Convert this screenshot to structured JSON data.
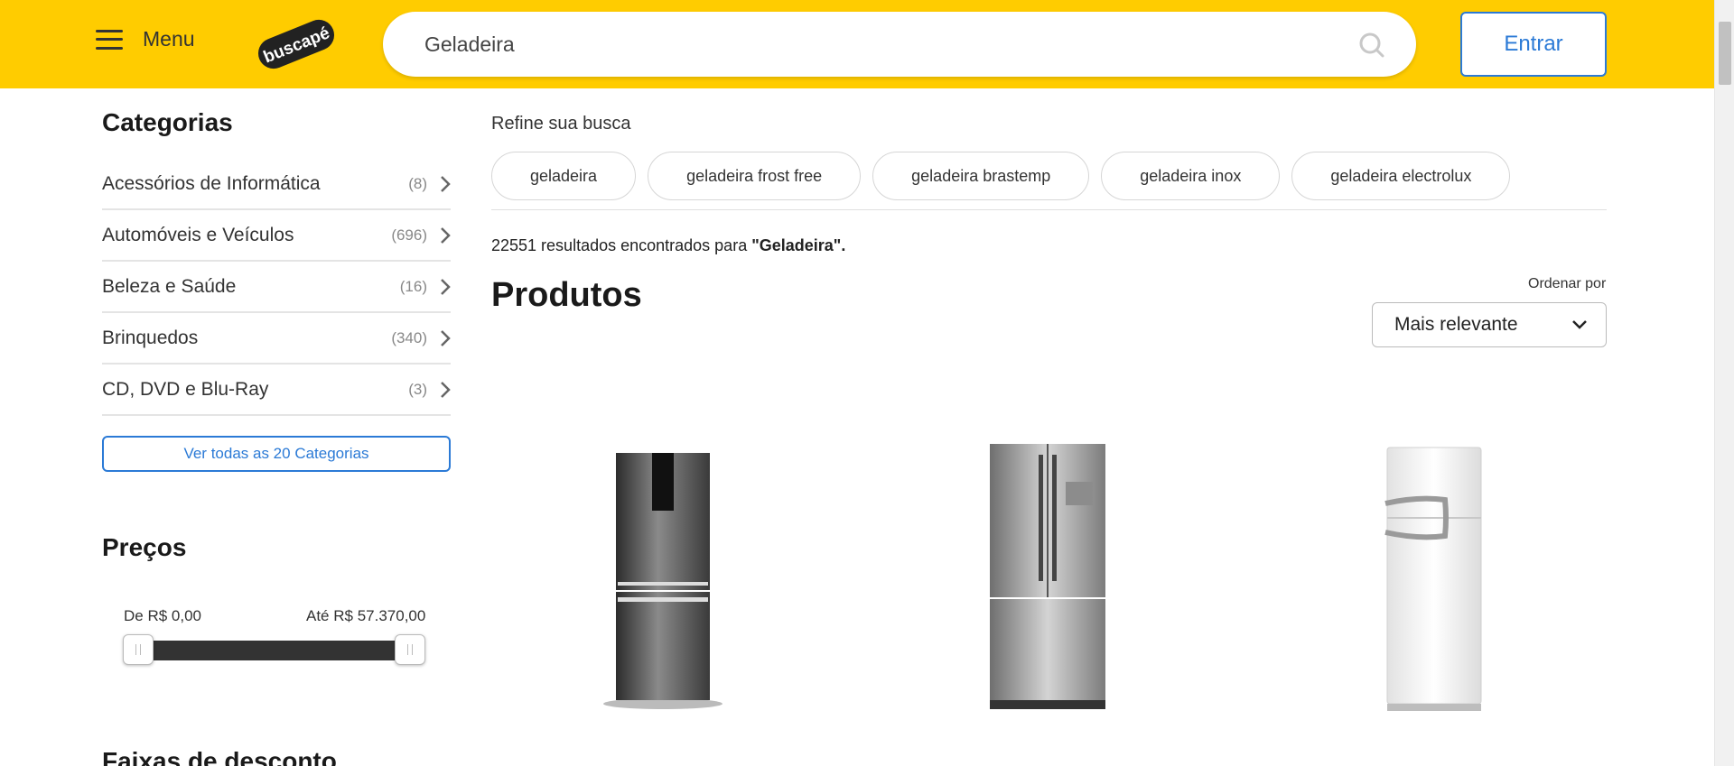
{
  "header": {
    "menu_label": "Menu",
    "logo_text": "buscapé",
    "search_value": "Geladeira",
    "login_label": "Entrar"
  },
  "sidebar": {
    "categories_title": "Categorias",
    "categories": [
      {
        "name": "Acessórios de Informática",
        "count": "(8)"
      },
      {
        "name": "Automóveis e Veículos",
        "count": "(696)"
      },
      {
        "name": "Beleza e Saúde",
        "count": "(16)"
      },
      {
        "name": "Brinquedos",
        "count": "(340)"
      },
      {
        "name": "CD, DVD e Blu-Ray",
        "count": "(3)"
      }
    ],
    "all_categories_label": "Ver todas as 20 Categorias",
    "prices_title": "Preços",
    "price_from": "De R$ 0,00",
    "price_to": "Até R$ 57.370,00",
    "price_range_fraction": [
      0,
      1
    ],
    "discount_title": "Faixas de desconto"
  },
  "main": {
    "refine_label": "Refine sua busca",
    "chips": [
      "geladeira",
      "geladeira frost free",
      "geladeira brastemp",
      "geladeira inox",
      "geladeira electrolux"
    ],
    "results_prefix": "22551 resultados encontrados para ",
    "results_query": "\"Geladeira\"",
    "results_suffix": ".",
    "products_title": "Produtos",
    "sort_label": "Ordenar por",
    "sort_value": "Mais relevante"
  },
  "colors": {
    "brand_yellow": "#ffcc00",
    "link_blue": "#2b7ad6"
  }
}
